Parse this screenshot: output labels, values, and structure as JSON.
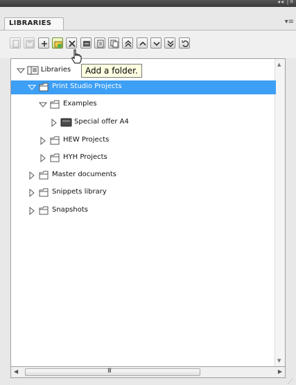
{
  "panel": {
    "tab_label": "LIBRARIES",
    "collapse_glyph": "◂◂",
    "close_glyph": "|✕",
    "menu_glyph": "▾≡"
  },
  "toolbar": {
    "buttons": [
      {
        "name": "new-library-icon",
        "enabled": false
      },
      {
        "name": "save-icon",
        "enabled": false
      },
      {
        "name": "add-icon",
        "enabled": true
      },
      {
        "name": "add-folder-icon",
        "enabled": true
      },
      {
        "name": "delete-icon",
        "enabled": true
      },
      {
        "name": "rename-icon",
        "enabled": true
      },
      {
        "name": "properties-icon",
        "enabled": true
      },
      {
        "name": "copy-icon",
        "enabled": true
      },
      {
        "name": "collapse-all-icon",
        "enabled": true
      },
      {
        "name": "move-up-icon",
        "enabled": true
      },
      {
        "name": "move-down-icon",
        "enabled": true
      },
      {
        "name": "expand-all-icon",
        "enabled": true
      },
      {
        "name": "refresh-icon",
        "enabled": true
      }
    ]
  },
  "tooltip": {
    "text": "Add a folder."
  },
  "tree": {
    "items": [
      {
        "label": "Libraries",
        "depth": 0,
        "expanded": true,
        "selected": false,
        "kind": "root"
      },
      {
        "label": "Print Studio Projects",
        "depth": 1,
        "expanded": true,
        "selected": true,
        "kind": "folder"
      },
      {
        "label": "Examples",
        "depth": 2,
        "expanded": true,
        "selected": false,
        "kind": "folder"
      },
      {
        "label": "Special offer A4",
        "depth": 3,
        "expanded": false,
        "selected": false,
        "kind": "document"
      },
      {
        "label": "HEW Projects",
        "depth": 2,
        "expanded": false,
        "selected": false,
        "kind": "folder"
      },
      {
        "label": "HYH Projects",
        "depth": 2,
        "expanded": false,
        "selected": false,
        "kind": "folder"
      },
      {
        "label": "Master documents",
        "depth": 1,
        "expanded": false,
        "selected": false,
        "kind": "folder"
      },
      {
        "label": "Snippets library",
        "depth": 1,
        "expanded": false,
        "selected": false,
        "kind": "folder"
      },
      {
        "label": "Snapshots",
        "depth": 1,
        "expanded": false,
        "selected": false,
        "kind": "folder"
      }
    ]
  },
  "scrollbar": {
    "grip": "III"
  },
  "colors": {
    "selection": "#3d9ff5",
    "tooltip_bg": "#ffffe1"
  }
}
